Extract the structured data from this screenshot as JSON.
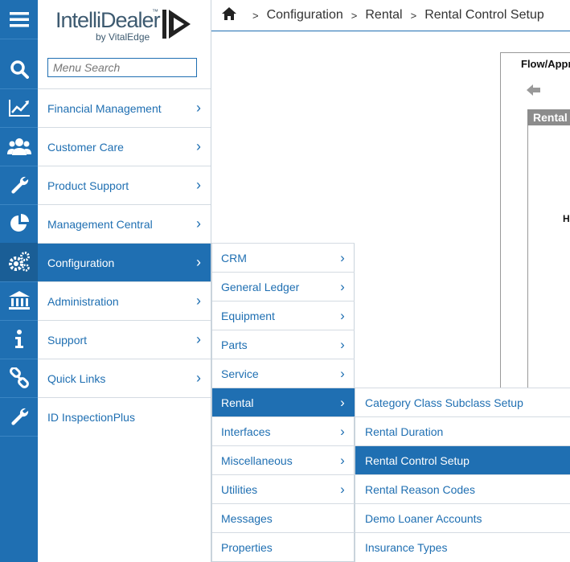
{
  "colors": {
    "accent": "#1f6fb2",
    "rail": "#1f6fb2",
    "active_bg": "#1f6fb2",
    "divider": "#d4dbe2"
  },
  "logo": {
    "name": "IntelliDealer",
    "tm": "™",
    "sub": "by VitalEdge"
  },
  "search": {
    "placeholder": "Menu Search"
  },
  "rail": {
    "icons": [
      "hamburger-icon",
      "search-icon",
      "chart-icon",
      "users-icon",
      "wrench-icon",
      "pie-chart-icon",
      "gears-icon",
      "bank-icon",
      "info-icon",
      "link-icon",
      "wrench-icon"
    ]
  },
  "main_menu": {
    "items": [
      {
        "label": "Financial Management"
      },
      {
        "label": "Customer Care"
      },
      {
        "label": "Product Support"
      },
      {
        "label": "Management Central"
      },
      {
        "label": "Configuration"
      },
      {
        "label": "Administration"
      },
      {
        "label": "Support"
      },
      {
        "label": "Quick Links"
      },
      {
        "label": "ID InspectionPlus"
      }
    ],
    "active_index": 4
  },
  "breadcrumb": {
    "items": [
      "Configuration",
      "Rental",
      "Rental Control Setup"
    ],
    "separator": ">"
  },
  "background_page": {
    "tab_label": "Flow/Approvals",
    "panel_header": "Rental",
    "fragment": "H"
  },
  "sub_menu": {
    "items": [
      {
        "label": "CRM"
      },
      {
        "label": "General Ledger"
      },
      {
        "label": "Equipment"
      },
      {
        "label": "Parts"
      },
      {
        "label": "Service"
      },
      {
        "label": "Rental"
      },
      {
        "label": "Interfaces"
      },
      {
        "label": "Miscellaneous"
      },
      {
        "label": "Utilities"
      },
      {
        "label": "Messages"
      },
      {
        "label": "Properties"
      }
    ],
    "active_index": 5
  },
  "third_menu": {
    "items": [
      {
        "label": "Category Class Subclass Setup"
      },
      {
        "label": "Rental Duration"
      },
      {
        "label": "Rental Control Setup"
      },
      {
        "label": "Rental Reason Codes"
      },
      {
        "label": "Demo Loaner Accounts"
      },
      {
        "label": "Insurance Types"
      }
    ],
    "active_index": 2
  },
  "chevron": "›"
}
